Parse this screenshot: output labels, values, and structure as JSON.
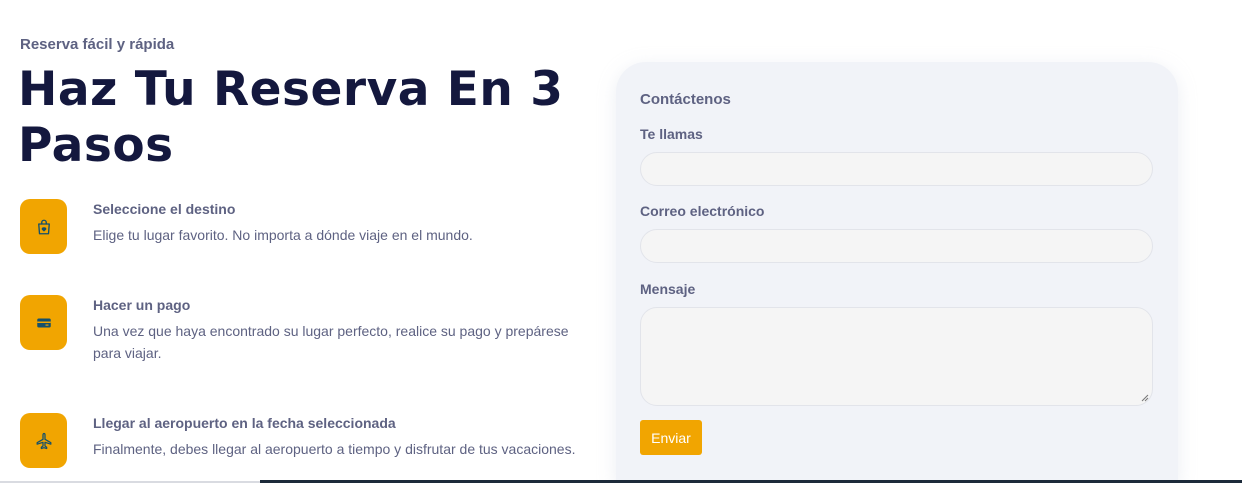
{
  "header": {
    "eyebrow": "Reserva fácil y rápida",
    "title": "Haz Tu Reserva En 3 Pasos"
  },
  "steps": [
    {
      "icon": "shopping-bag-icon",
      "title": "Seleccione el destino",
      "description": "Elige tu lugar favorito. No importa a dónde viaje en el mundo."
    },
    {
      "icon": "credit-card-icon",
      "title": "Hacer un pago",
      "description": "Una vez que haya encontrado su lugar perfecto, realice su pago y prepárese para viajar."
    },
    {
      "icon": "airplane-icon",
      "title": "Llegar al aeropuerto en la fecha seleccionada",
      "description": "Finalmente, debes llegar al aeropuerto a tiempo y disfrutar de tus vacaciones."
    }
  ],
  "contact_form": {
    "title": "Contáctenos",
    "name_label": "Te llamas",
    "name_value": "",
    "email_label": "Correo electrónico",
    "email_value": "",
    "message_label": "Mensaje",
    "message_value": "",
    "submit_label": "Enviar"
  },
  "colors": {
    "accent": "#f1a501",
    "heading": "#14183e",
    "text": "#5e6282",
    "card_bg": "#f1f3f8"
  }
}
